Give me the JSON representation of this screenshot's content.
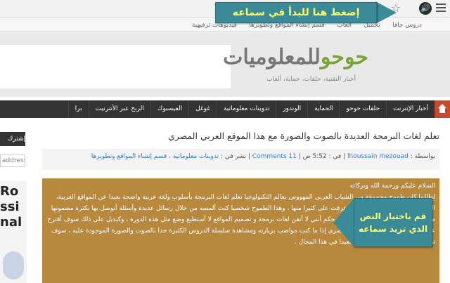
{
  "browser": {
    "bookmarks": [
      "فيديوهات ترفيهية",
      "قسم إنشاء المواقع وتطويرها",
      "ألعاب",
      "تحميل",
      "دروس جافا"
    ]
  },
  "callouts": {
    "top": "إضغط هنا للبدأ في سماعه",
    "middle_line1": "قم باختيار النص",
    "middle_line2": "الذي تريد سماعه"
  },
  "site": {
    "logo_main": "حوحو",
    "logo_rest": "للمعلوميات",
    "tagline": "أخبار التقنية، حلقات، حماية، ألعاب"
  },
  "nav": {
    "items": [
      "أخبار الإنترنت",
      "حلقات حوحو",
      "الحماية",
      "الوندوز",
      "تدوينات معلوماتية",
      "غوغل",
      "الفيسبوك",
      "الربح عبر الأنترنيت",
      "برا"
    ]
  },
  "sidebar": {
    "button_label": "إشترك",
    "input_placeholder": "address",
    "ad_text": "Ro\nssi\nnal"
  },
  "post": {
    "title": "تعلم لغات البرمجة العديدة بالصوت والصورة مع هذا الموقع العربي المصري",
    "meta_by": "بواسطة :",
    "meta_author": "lhoussain mezouad",
    "meta_in": "| في :",
    "meta_time": "5:52 ص",
    "meta_comments": "Comments 11",
    "meta_published": "| نشر في :",
    "meta_categories": "تدوينات معلوماتية ، قسم إنشاء المواقع وتطويرها",
    "paragraphs": [
      "السلام عليكم ورحمة الله وبركاته",
      "لطالما كان طموح مجموعة من الشباب العربي المهووس بعالم التكنولوجيا تعلم لغات البرمجة بأسلوب ولغة عربية واضحة بعيدا عن المواقع الغربية، الكثيرة جدا والتي كانت لي تدوينة عرفت على كثيرا منها ، وهذا الطموح شخصيا كنت ألمسه من خلال رسائل عديدة وأسئلة أتوصل بها بكثرة مضمونها طلب وضع دورة في هذا المجال ،لكن بحكم أنني لا أتقن لغات برمجة و تصميم المواقع لا أستطيع وضع مثل هذه الدورة ، وكبديل على ذلك سوف أقترح عليك في هذه التدوينة موقع عربي مصري إذا ما كنت مواضب بزيارته ومشاهدة سلسلة الدروس الكثيرة جدا بالصوت والصورة الموجودة عليه ، سوف تطور بكل تأكيد مستواك وتذهب بعيدا في هذا المجال ."
    ]
  }
}
